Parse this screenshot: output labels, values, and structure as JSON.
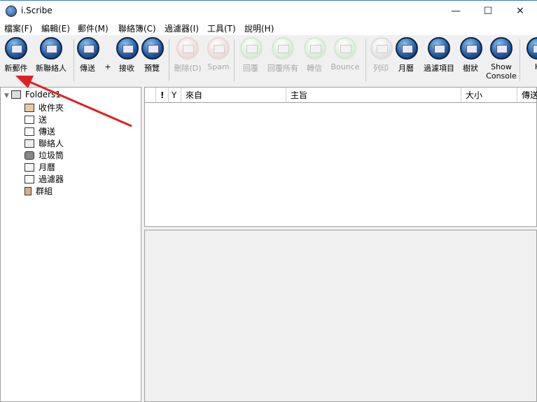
{
  "window": {
    "title": "i.Scribe",
    "minimize": "—",
    "maximize": "☐",
    "close": "✕"
  },
  "menu": [
    "檔案(F)",
    "編輯(E)",
    "郵件(M)",
    "聯絡簿(C)",
    "過濾器(I)",
    "工具(T)",
    "說明(H)"
  ],
  "toolbar": [
    {
      "label": "新郵件",
      "icon": "new-mail-icon",
      "enabled": true
    },
    {
      "label": "新聯絡人",
      "icon": "new-contact-icon",
      "enabled": true
    },
    {
      "label": "傳送",
      "icon": "send-icon",
      "enabled": true
    },
    {
      "label": "+",
      "icon": "",
      "enabled": true
    },
    {
      "label": "接收",
      "icon": "receive-icon",
      "enabled": true
    },
    {
      "label": "預覽",
      "icon": "preview-icon",
      "enabled": true
    },
    {
      "label": "刪除(D)",
      "icon": "delete-icon",
      "enabled": false
    },
    {
      "label": "Spam",
      "icon": "spam-icon",
      "enabled": false
    },
    {
      "label": "回覆",
      "icon": "reply-icon",
      "enabled": false
    },
    {
      "label": "回覆所有",
      "icon": "reply-all-icon",
      "enabled": false
    },
    {
      "label": "轉信",
      "icon": "forward-icon",
      "enabled": false
    },
    {
      "label": "Bounce",
      "icon": "bounce-icon",
      "enabled": false
    },
    {
      "label": "列印",
      "icon": "print-icon",
      "enabled": false
    },
    {
      "label": "月曆",
      "icon": "calendar-icon",
      "enabled": true
    },
    {
      "label": "過濾項目",
      "icon": "filter-icon",
      "enabled": true
    },
    {
      "label": "樹狀",
      "icon": "tree-icon",
      "enabled": true
    },
    {
      "label": "Show",
      "label2": "Console",
      "icon": "console-icon",
      "enabled": true
    },
    {
      "label": "H",
      "icon": "help-icon",
      "enabled": true
    }
  ],
  "folders": {
    "root": "Folders1",
    "items": [
      "收件夾",
      "送",
      "傳送",
      "聯絡人",
      "垃圾筒",
      "月曆",
      "過濾器",
      "群組"
    ]
  },
  "list": {
    "columns": [
      "!",
      "Y",
      "來自",
      "主旨",
      "大小",
      "傳送"
    ]
  }
}
